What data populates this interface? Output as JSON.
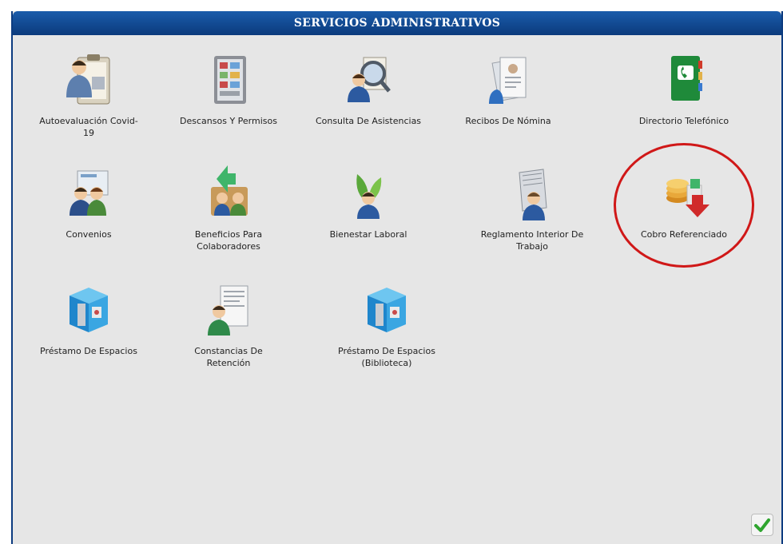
{
  "header": {
    "title": "SERVICIOS ADMINISTRATIVOS"
  },
  "items": [
    {
      "label": "Autoevaluación Covid-\n19",
      "icon": "clipboard-doctor-icon"
    },
    {
      "label": "Descansos Y Permisos",
      "icon": "calendar-board-icon"
    },
    {
      "label": "Consulta De Asistencias",
      "icon": "magnifier-person-icon"
    },
    {
      "label": "Recibos De Nómina",
      "icon": "payslip-documents-icon"
    },
    {
      "label": "Directorio Telefónico",
      "icon": "phone-book-icon"
    },
    {
      "label": "Convenios",
      "icon": "partners-icon"
    },
    {
      "label": "Beneficios Para\nColaboradores",
      "icon": "benefits-icon"
    },
    {
      "label": "Bienestar Laboral",
      "icon": "wellness-icon"
    },
    {
      "label": "Reglamento Interior De\nTrabajo",
      "icon": "regulation-book-icon"
    },
    {
      "label": "Cobro Referenciado",
      "icon": "coins-payment-icon"
    },
    {
      "label": "Préstamo De Espacios",
      "icon": "space-cube-icon"
    },
    {
      "label": "Constancias De\nRetención",
      "icon": "certificate-person-icon"
    },
    {
      "label": "Préstamo De Espacios\n(Biblioteca)",
      "icon": "space-cube-library-icon"
    }
  ],
  "footer": {
    "confirm_icon": "checkmark-icon"
  },
  "colors": {
    "header": "#0b3a7c",
    "panel": "#e6e6e6",
    "highlight": "#d01818",
    "check": "#2fa52f"
  }
}
